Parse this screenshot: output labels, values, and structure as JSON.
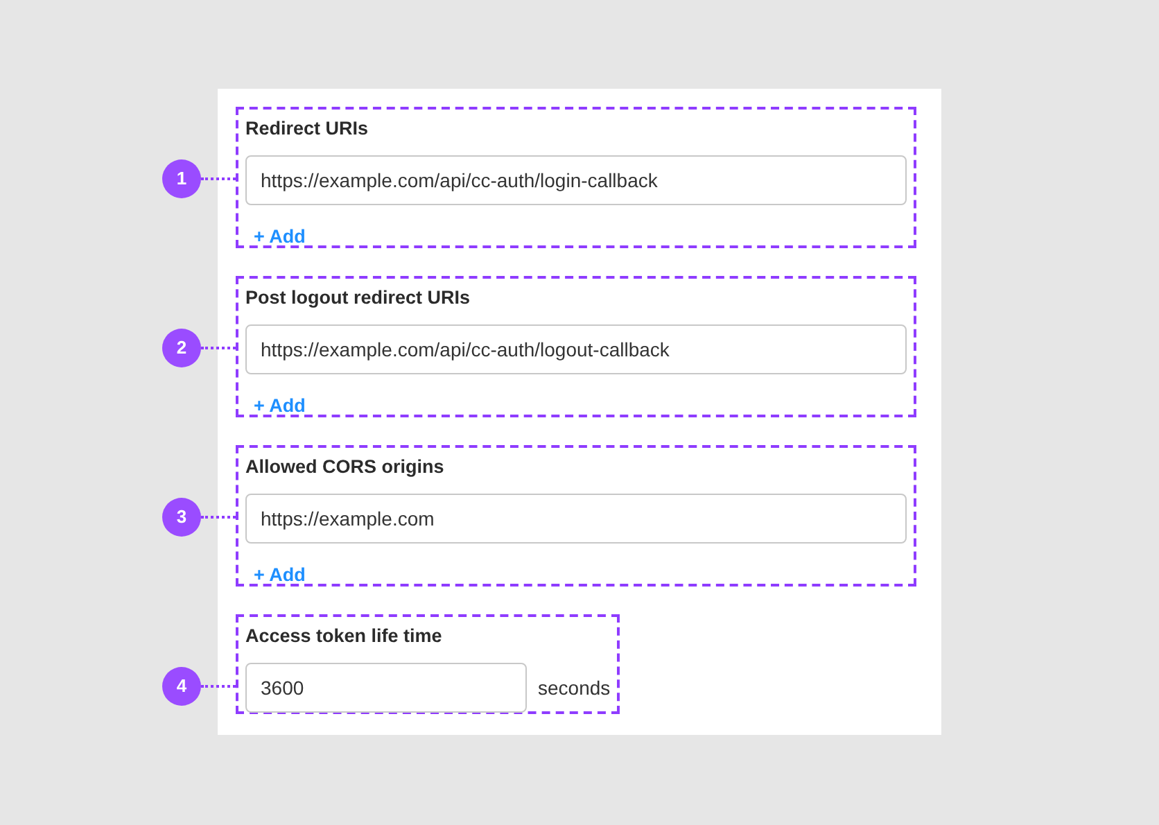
{
  "sections": [
    {
      "kind": "list",
      "marker": "1",
      "label": "Redirect URIs",
      "values": [
        "https://example.com/api/cc-auth/login-callback"
      ],
      "add": "+ Add"
    },
    {
      "kind": "list",
      "marker": "2",
      "label": "Post logout redirect URIs",
      "values": [
        "https://example.com/api/cc-auth/logout-callback"
      ],
      "add": "+ Add"
    },
    {
      "kind": "list",
      "marker": "3",
      "label": "Allowed CORS origins",
      "values": [
        "https://example.com"
      ],
      "add": "+ Add"
    },
    {
      "kind": "duration",
      "marker": "4",
      "label": "Access token life time",
      "value": "3600",
      "unit": "seconds"
    }
  ]
}
